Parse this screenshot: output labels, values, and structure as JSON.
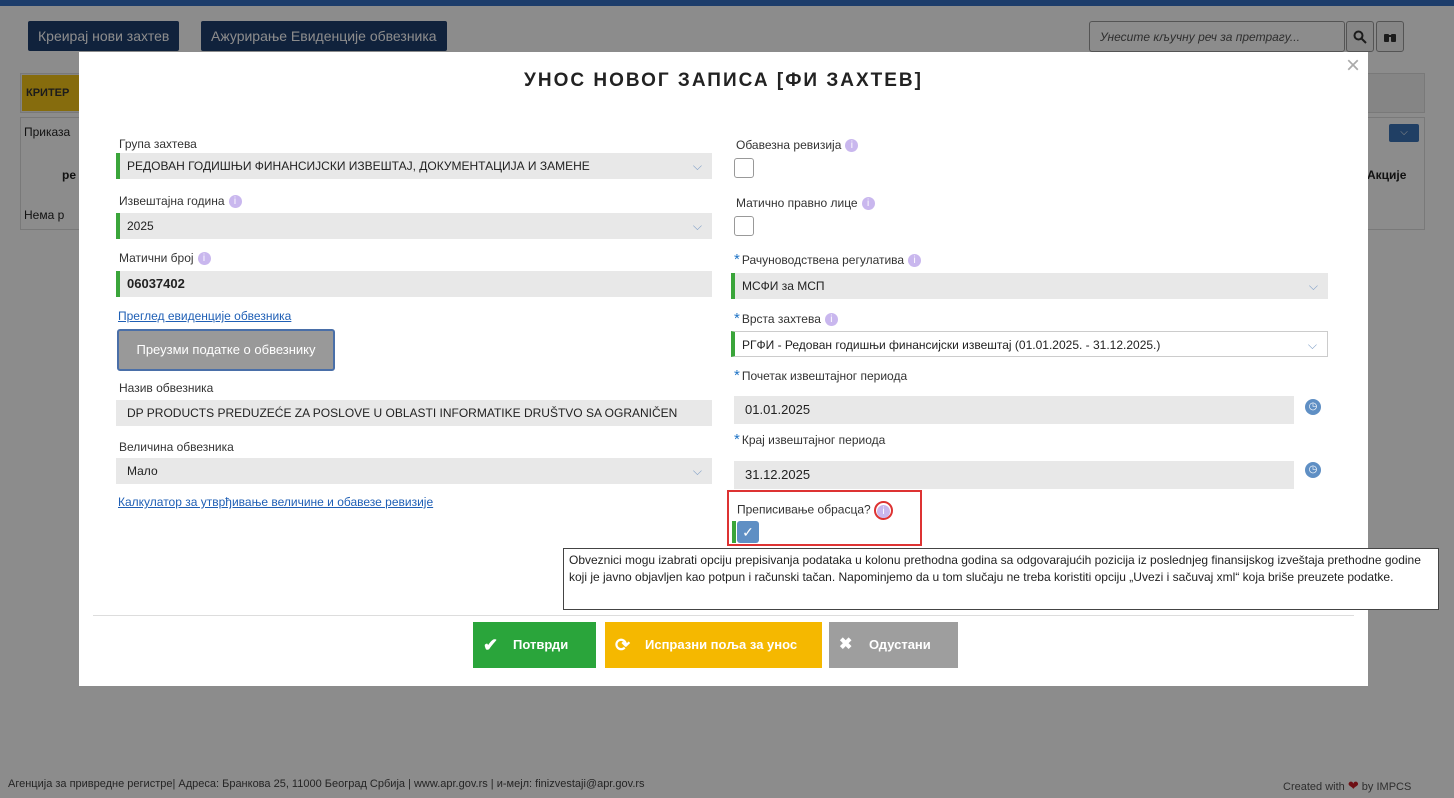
{
  "top_buttons": {
    "create": "Креирај нови захтев",
    "update": "Ажурирање Евиденције обвезника"
  },
  "search": {
    "placeholder": "Унесите кључну реч за претрагу..."
  },
  "background": {
    "criteria_tab": "КРИТЕР",
    "show_label": "Приказа",
    "col_short": "ре",
    "actions_header": "Акције",
    "no_results": "Нема р"
  },
  "modal": {
    "title": "УНОС НОВОГ ЗАПИСА [ФИ ЗАХТЕВ]",
    "left": {
      "request_group_label": "Група захтева",
      "request_group_value": "РЕДОВАН ГОДИШЊИ ФИНАНСИЈСКИ ИЗВЕШТАЈ, ДОКУМЕНТАЦИЈА И ЗАМЕНЕ",
      "report_year_label": "Извештајна година",
      "report_year_value": "2025",
      "reg_number_label": "Матични број",
      "reg_number_value": "06037402",
      "registry_link": "Преглед евиденције обвезника",
      "fetch_button": "Преузми податке о обвезнику",
      "name_label": "Назив обвезника",
      "name_value": "DP PRODUCTS PREDUZEĆE ZA POSLOVE U OBLASTI INFORMATIKE DRUŠTVO SA OGRANIČEN",
      "size_label": "Величина обвезника",
      "size_value": "Мало",
      "calculator_link": "Калкулатор за утврђивање величине и обавезе ревизије"
    },
    "right": {
      "mandatory_audit_label": "Обавезна ревизија",
      "parent_entity_label": "Матично правно лице",
      "accounting_reg_label": "Рачуноводствена регулатива",
      "accounting_reg_value": "МСФИ за МСП",
      "request_type_label": "Врста захтева",
      "request_type_value": "РГФИ - Редован годишњи финансијски извештај (01.01.2025. - 31.12.2025.)",
      "period_start_label": "Почетак извештајног периода",
      "period_start_value": "01.01.2025",
      "period_end_label": "Крај извештајног периода",
      "period_end_value": "31.12.2025",
      "copy_form_label": "Преписивање обрасца?"
    },
    "tooltip": "Obveznici mogu izabrati opciju prepisivanja podataka u kolonu prethodna godina sa odgovarajućih pozicija iz poslednjeg finansijskog izveštaja prethodne godine koji je javno objavljen kao potpun i računski tačan. Napominjemo da u tom slučaju ne treba koristiti opciju „Uvezi i sačuvaj xml“ koja briše preuzete podatke.",
    "buttons": {
      "confirm": "Потврди",
      "clear": "Испразни поља за унос",
      "cancel": "Одустани"
    }
  },
  "footer": {
    "left": "Агенција за привредне регистре| Адреса: Бранкова 25, 11000 Београд Србија | www.apr.gov.rs | и-мејл: finizvestaji@apr.gov.rs",
    "created_with": "Created with",
    "by": "by IMPCS"
  },
  "colors": {
    "navy": "#1e3e6e",
    "green": "#3aa53a",
    "yellow": "#f5b800",
    "grey_button": "#9e9e9e",
    "highlight_red": "#dd3333"
  }
}
